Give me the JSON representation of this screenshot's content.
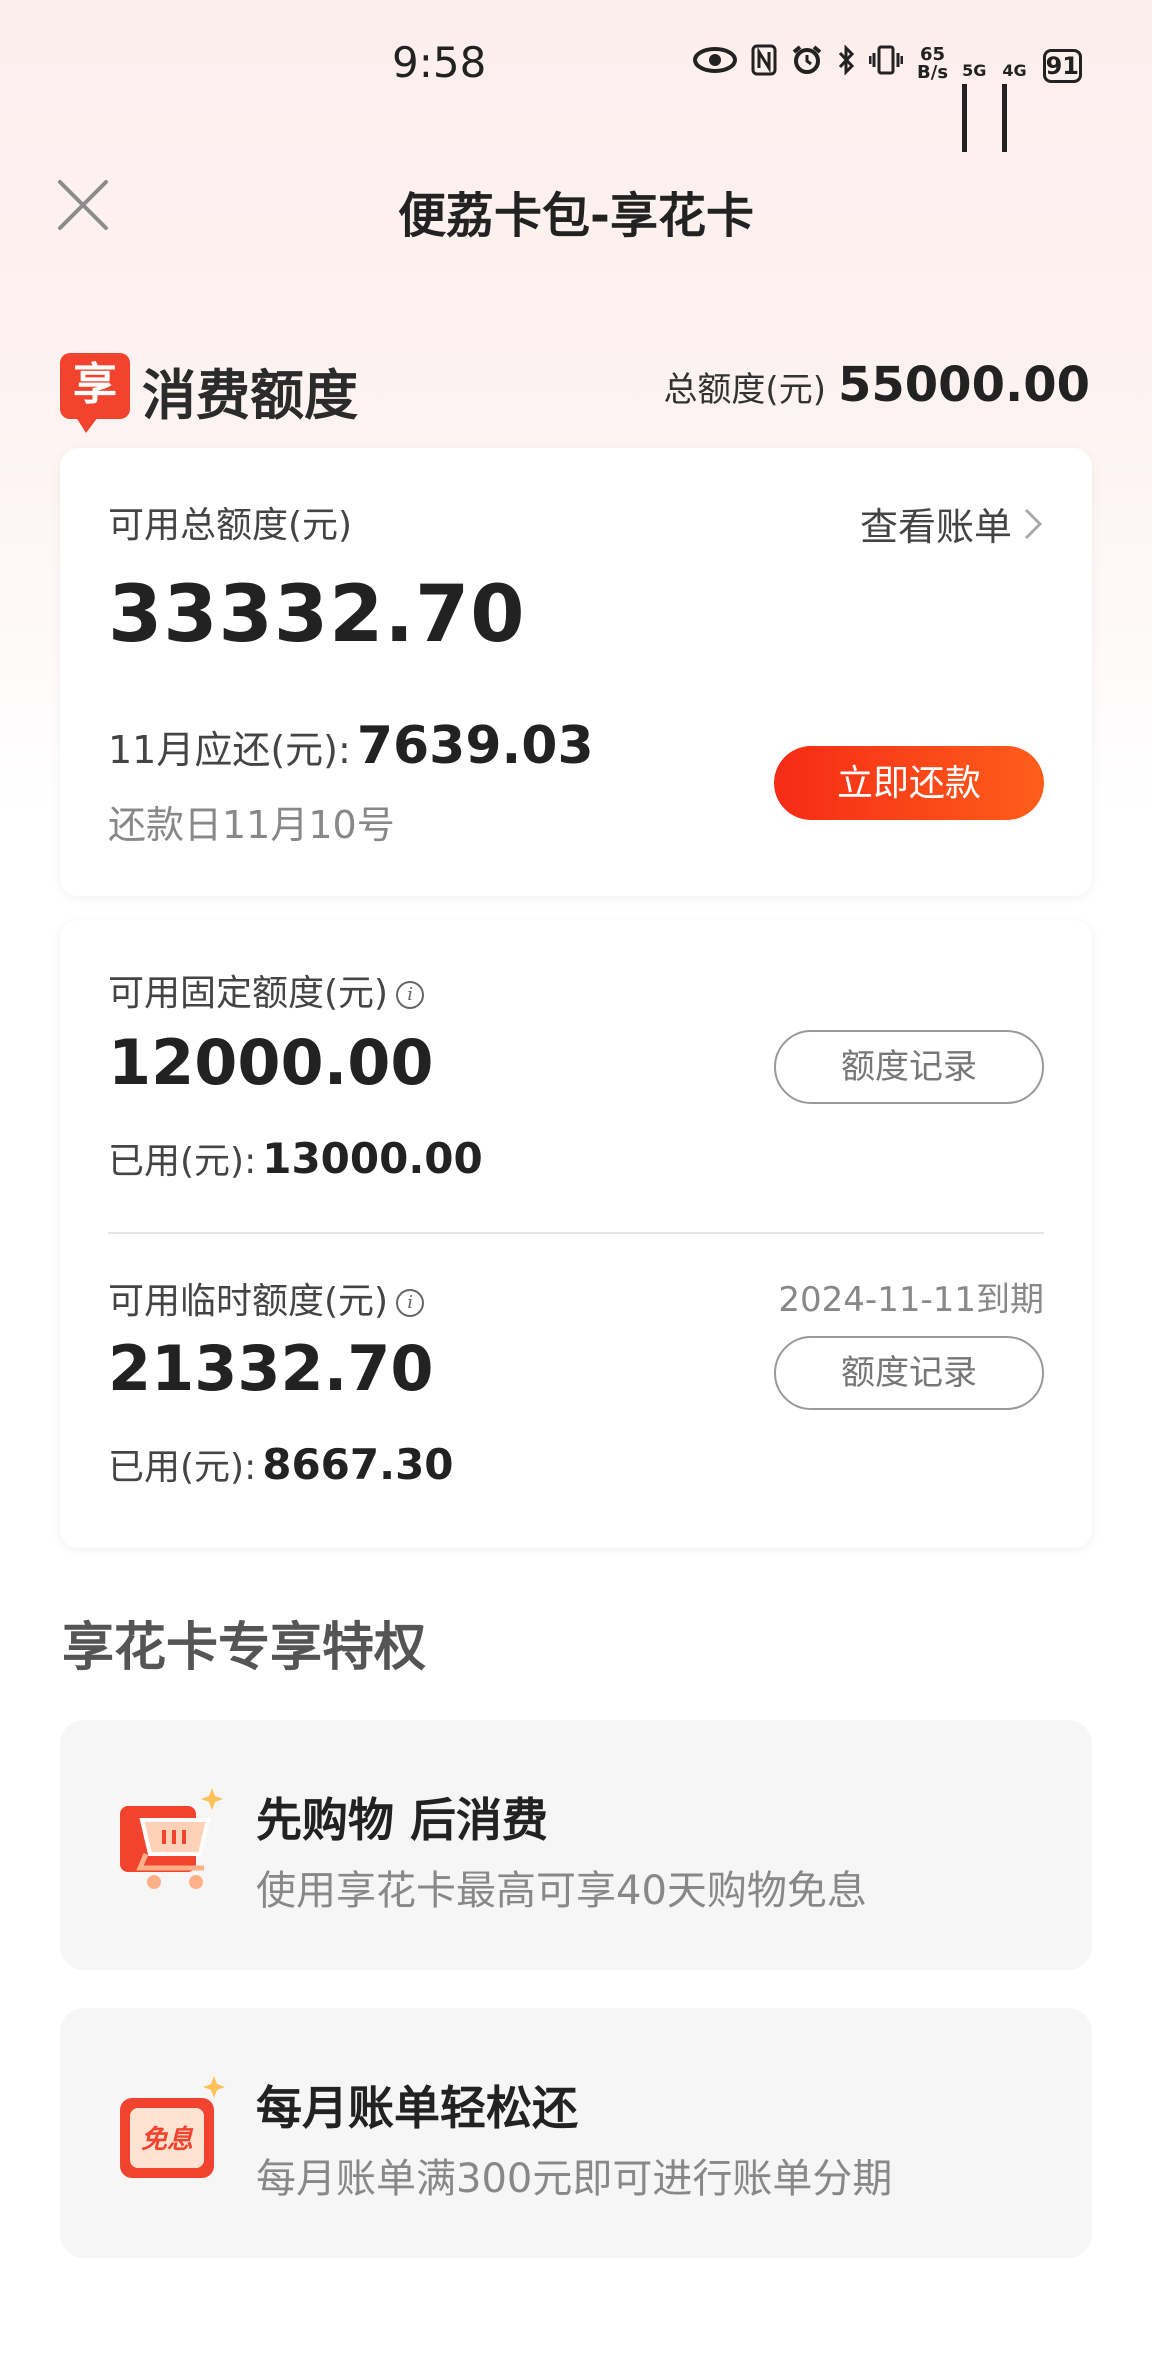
{
  "status_bar": {
    "time": "9:58",
    "net_speed_value": "65",
    "net_speed_unit": "B/s",
    "sim1_tag": "5G",
    "sim2_tag": "4G",
    "battery": "91"
  },
  "nav": {
    "title": "便荔卡包-享花卡"
  },
  "quota": {
    "logo_text": "享",
    "title": "消费额度",
    "total_label": "总额度(元)",
    "total_value": "55000.00"
  },
  "summary": {
    "available_label": "可用总额度(元)",
    "view_bill": "查看账单",
    "available_value": "33332.70",
    "due_label": "11月应还(元):",
    "due_value": "7639.03",
    "due_date": "还款日11月10号",
    "repay_button": "立即还款"
  },
  "fixed": {
    "label": "可用固定额度(元)",
    "value": "12000.00",
    "used_label": "已用(元):",
    "used_value": "13000.00",
    "record_button": "额度记录"
  },
  "temporary": {
    "label": "可用临时额度(元)",
    "expiry": "2024-11-11到期",
    "value": "21332.70",
    "used_label": "已用(元):",
    "used_value": "8667.30",
    "record_button": "额度记录"
  },
  "privileges": {
    "title": "享花卡专享特权",
    "items": [
      {
        "icon": "shopping-cart-icon",
        "name": "先购物 后消费",
        "desc": "使用享花卡最高可享40天购物免息"
      },
      {
        "icon": "interest-free-icon",
        "icon_text": "免息",
        "name": "每月账单轻松还",
        "desc": "每月账单满300元即可进行账单分期"
      }
    ]
  },
  "colors": {
    "accent_red": "#f52b16",
    "accent_orange": "#ff5e1a",
    "logo_red": "#f2432e"
  }
}
